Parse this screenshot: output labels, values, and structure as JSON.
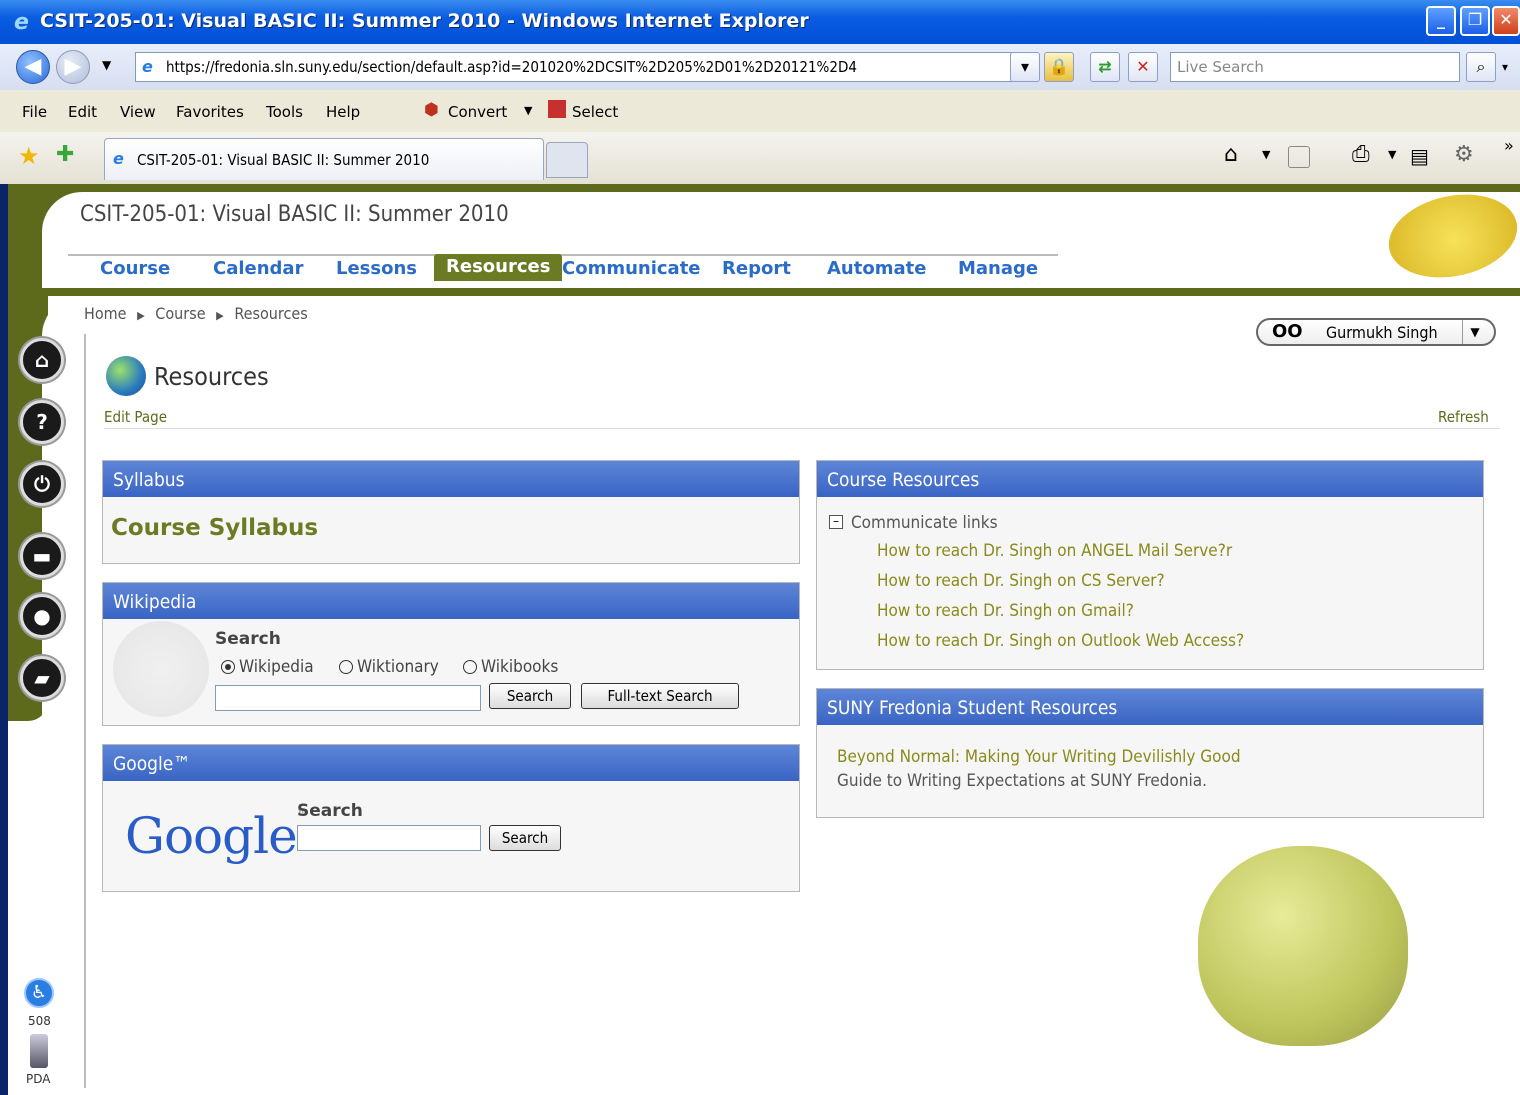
{
  "window": {
    "title": "CSIT-205-01: Visual BASIC II: Summer 2010 - Windows Internet Explorer",
    "minimize": "_",
    "restore": "❐",
    "close": "✕"
  },
  "address": {
    "url": "https://fredonia.sln.suny.edu/section/default.asp?id=201020%2DCSIT%2D205%2D01%2D20121%2D4",
    "search_placeholder": "Live Search"
  },
  "menu": {
    "items": [
      "File",
      "Edit",
      "View",
      "Favorites",
      "Tools",
      "Help"
    ],
    "convert": "Convert",
    "select": "Select"
  },
  "tab": {
    "title": "CSIT-205-01: Visual BASIC II: Summer 2010"
  },
  "course": {
    "title": "CSIT-205-01: Visual BASIC II: Summer 2010",
    "nav": [
      "Course",
      "Calendar",
      "Lessons",
      "Resources",
      "Communicate",
      "Report",
      "Automate",
      "Manage"
    ],
    "active_nav": "Resources"
  },
  "breadcrumb": {
    "home": "Home",
    "course": "Course",
    "current": "Resources",
    "sep": "▶"
  },
  "user": {
    "name": "Gurmukh Singh"
  },
  "page": {
    "title": "Resources",
    "edit": "Edit Page",
    "refresh": "Refresh"
  },
  "syllabus": {
    "header": "Syllabus",
    "link": "Course Syllabus"
  },
  "wikipedia": {
    "header": "Wikipedia",
    "search_label": "Search",
    "options": [
      "Wikipedia",
      "Wiktionary",
      "Wikibooks"
    ],
    "selected": "Wikipedia",
    "search_button": "Search",
    "fulltext_button": "Full-text Search"
  },
  "google": {
    "header": "Google™",
    "logo": "Google",
    "tm": "™",
    "search_label": "Search",
    "search_button": "Search"
  },
  "course_resources": {
    "header": "Course Resources",
    "group": "Communicate links",
    "links": [
      "How to reach Dr. Singh on ANGEL Mail Serve?r",
      "How to reach Dr. Singh on CS Server?",
      "How to reach Dr. Singh on Gmail?",
      "How to reach Dr. Singh on Outlook Web Access?"
    ]
  },
  "suny": {
    "header": "SUNY Fredonia Student Resources",
    "links": [
      "Beyond Normal: Making Your Writing Devilishly Good",
      "Guide to Writing Expectations at SUNY Fredonia."
    ]
  },
  "accessibility": {
    "label_508": "508",
    "label_pda": "PDA"
  },
  "colors": {
    "olive": "#5d6a1c",
    "panel_header": "#3a64c4",
    "nav_link": "#2a6cc8"
  }
}
